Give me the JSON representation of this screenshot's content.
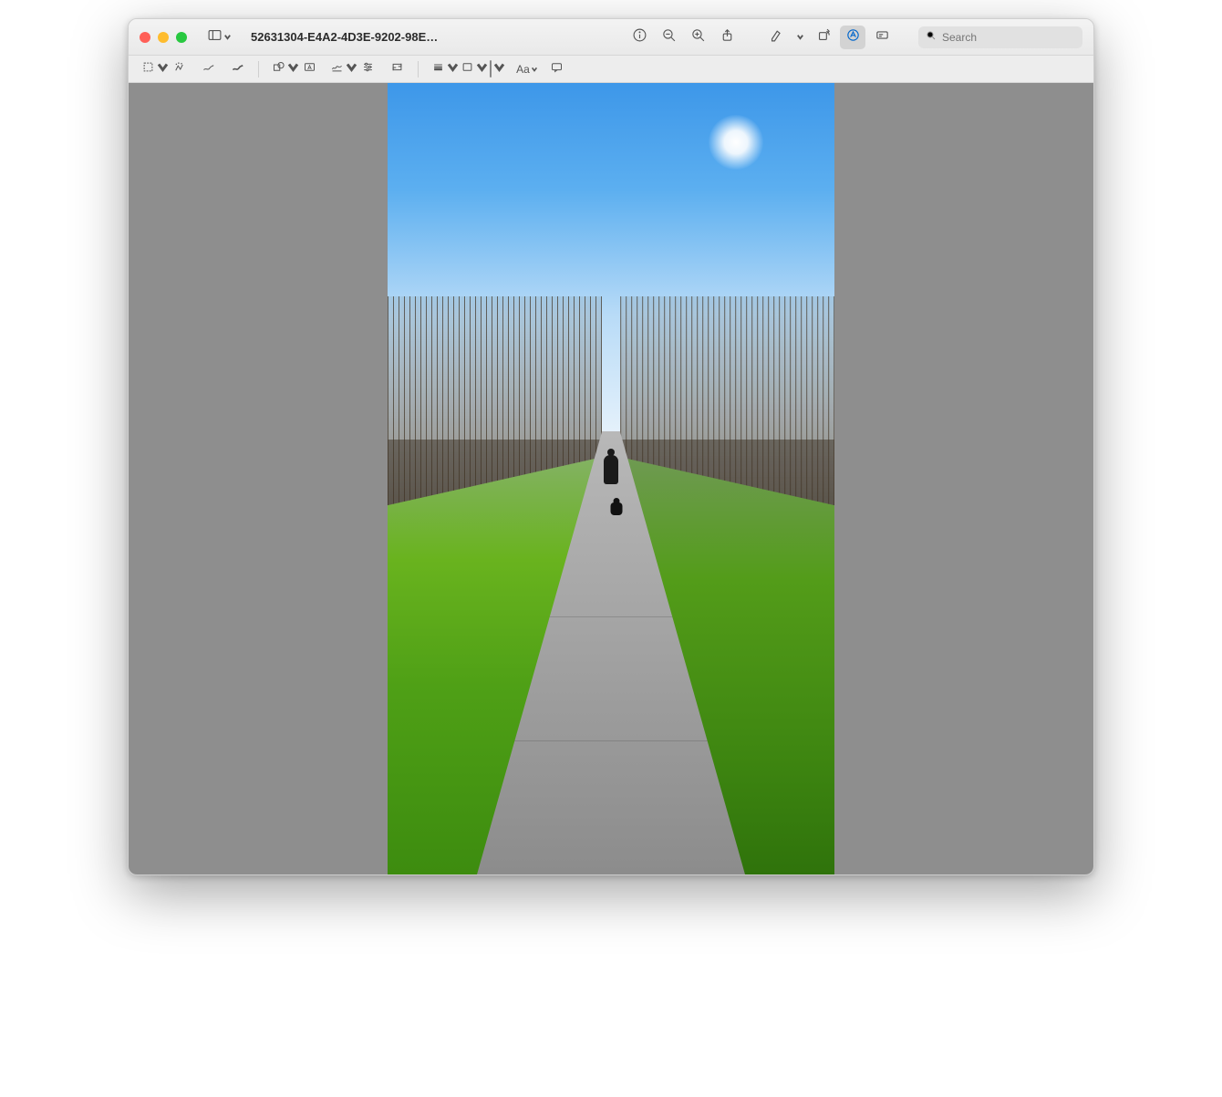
{
  "window": {
    "title": "52631304-E4A2-4D3E-9202-98E…"
  },
  "titlebar_icons": {
    "sidebar": "sidebar-icon",
    "info": "info-icon",
    "zoom_out": "zoom-out-icon",
    "zoom_in": "zoom-in-icon",
    "share": "share-icon",
    "highlight": "highlight-icon",
    "rotate": "rotate-icon",
    "markup": "markup-icon",
    "form": "form-icon"
  },
  "search": {
    "placeholder": "Search"
  },
  "markup_icons": {
    "selection": "selection-icon",
    "instant_alpha": "instant-alpha-icon",
    "sketch": "sketch-icon",
    "draw": "draw-icon",
    "shapes": "shapes-icon",
    "text": "text-icon",
    "sign": "sign-icon",
    "adjust": "adjust-icon",
    "crop": "crop-icon",
    "line_style": "line-style-icon",
    "border": "border-icon",
    "fill": "fill-icon",
    "font": "Aa",
    "annotate": "annotate-icon"
  }
}
